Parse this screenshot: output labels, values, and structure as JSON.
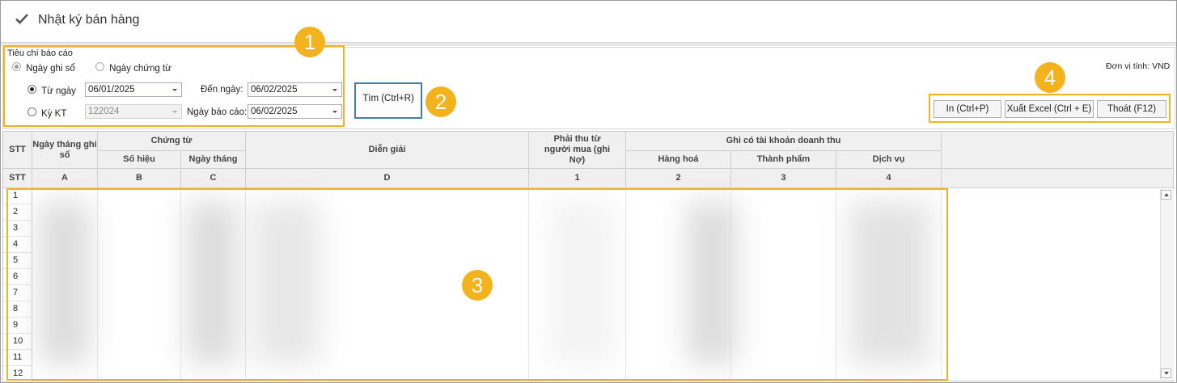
{
  "window": {
    "title": "Nhật ký bán hàng",
    "title_icon": "checkmark-icon"
  },
  "criteria": {
    "group_label": "Tiêu chí báo cáo",
    "date_type_options": [
      "Ngày ghi sổ",
      "Ngày chứng từ"
    ],
    "date_type_selected": "Ngày ghi sổ",
    "period_options": [
      "Từ ngày",
      "Kỳ KT"
    ],
    "period_selected": "Từ ngày",
    "from_date": "06/01/2025",
    "to_date_label": "Đến ngày:",
    "to_date": "06/02/2025",
    "period_value": "122024",
    "report_date_label": "Ngày báo cáo:",
    "report_date": "06/02/2025"
  },
  "actions": {
    "find": "Tìm  (Ctrl+R)",
    "print": "In  (Ctrl+P)",
    "export_excel": "Xuất Excel  (Ctrl + E)",
    "exit": "Thoát  (F12)"
  },
  "unit_label": "Đơn vị tính: VND",
  "grid": {
    "headers": {
      "stt": "STT",
      "posting_date": "Ngày tháng ghi sổ",
      "voucher_group": "Chứng từ",
      "voucher_no": "Số hiệu",
      "voucher_date": "Ngày tháng",
      "description": "Diễn giải",
      "receivable": "Phải thu từ người mua (ghi Nợ)",
      "revenue_group": "Ghi có tài khoản doanh thu",
      "goods": "Hàng hoá",
      "finished_goods": "Thành phẩm",
      "services": "Dịch vụ"
    },
    "codes": {
      "stt": "STT",
      "posting_date": "A",
      "voucher_no": "B",
      "voucher_date": "C",
      "description": "D",
      "receivable": "1",
      "goods": "2",
      "finished_goods": "3",
      "services": "4"
    },
    "row_numbers": [
      "1",
      "2",
      "3",
      "4",
      "5",
      "6",
      "7",
      "8",
      "9",
      "10",
      "11",
      "12"
    ]
  },
  "callouts": [
    "1",
    "2",
    "3",
    "4"
  ],
  "colors": {
    "callout": "#f4b21c",
    "find_border": "#3c7fb1"
  }
}
